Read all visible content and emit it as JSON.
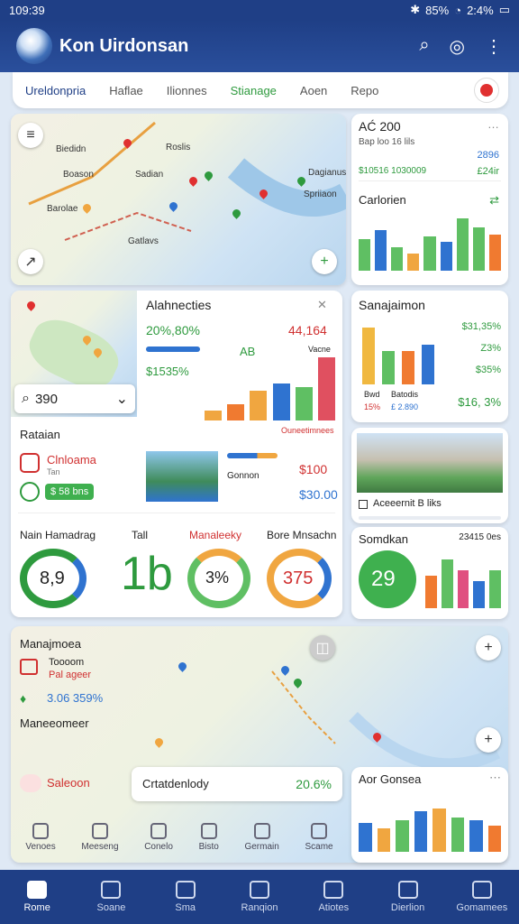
{
  "status": {
    "time": "109:39",
    "battery": "85%",
    "signal": "2:4%"
  },
  "app": {
    "title": "Kon Uirdonsan"
  },
  "tabs": [
    {
      "label": "Ureldonpria"
    },
    {
      "label": "Haflae"
    },
    {
      "label": "Ilionnes"
    },
    {
      "label": "Stianage"
    },
    {
      "label": "Aoen"
    },
    {
      "label": "Repo"
    }
  ],
  "map1": {
    "labels": [
      "Biedidn",
      "Roslis",
      "Boason",
      "Sadian",
      "Dagianus",
      "Barolae",
      "Gatlavs",
      "Spriiaon"
    ]
  },
  "stats1": {
    "title": "AĆ 200",
    "sub": "Bap loo 16 lils",
    "v1": "2896",
    "l1": "$10516 1030009",
    "v2": "£24ir",
    "section": "Carlorien",
    "bars": [
      {
        "v": 55,
        "c": "#5fbf63"
      },
      {
        "v": 70,
        "c": "#2f73d0"
      },
      {
        "v": 40,
        "c": "#5fbf63"
      },
      {
        "v": 30,
        "c": "#f0a640"
      },
      {
        "v": 60,
        "c": "#5fbf63"
      },
      {
        "v": 50,
        "c": "#2f73d0"
      },
      {
        "v": 90,
        "c": "#5fbf63"
      },
      {
        "v": 75,
        "c": "#5fbf63"
      },
      {
        "v": 62,
        "c": "#f07a30"
      }
    ]
  },
  "search": {
    "value": "390"
  },
  "alerts": {
    "title": "Alahnecties",
    "pct": "20%,80%",
    "value": "44,164",
    "sub": "$1535%",
    "ab": "AB",
    "vlabel": "Vacne",
    "legend": "Ouneetimnees",
    "bars": [
      {
        "v": 15,
        "c": "#f0a640"
      },
      {
        "v": 25,
        "c": "#f07a30"
      },
      {
        "v": 45,
        "c": "#f0a640"
      },
      {
        "v": 55,
        "c": "#2f73d0"
      },
      {
        "v": 50,
        "c": "#5fbf63"
      },
      {
        "v": 95,
        "c": "#e05060"
      }
    ]
  },
  "sanajaimon": {
    "title": "Sanajaimon",
    "v1": "$31,35%",
    "v2": "Z3%",
    "v3": "$35%",
    "v4": "$16, 3%",
    "foot1": "Bwd",
    "foot2": "Batodis",
    "foot3": "15%",
    "foot4": "£ 2.890",
    "bars": [
      {
        "v": 85,
        "c": "#f0b840"
      },
      {
        "v": 50,
        "c": "#5fbf63"
      },
      {
        "v": 50,
        "c": "#f07a30"
      },
      {
        "v": 60,
        "c": "#2f73d0"
      }
    ]
  },
  "rataian": {
    "title": "Rataian",
    "item1": "Clnloama",
    "item1sub": "Tan",
    "badge": "$ 58 bns",
    "imglabel": "Gonnon",
    "p1": "$100",
    "p2": "$30.00"
  },
  "photo": {
    "caption": "Aceeernit B liks"
  },
  "gauges": {
    "g1label": "Nain Hamadrag",
    "g1": "8,9",
    "g2label": "Tall",
    "g2": "1b",
    "g3label": "Manaleeky",
    "g3": "3%",
    "g4label": "Bore Mnsachn",
    "g4": "375"
  },
  "samo": {
    "title": "Somdkan",
    "sub": "23415 0es",
    "value": "29",
    "bars": [
      {
        "v": 60,
        "c": "#f07a30"
      },
      {
        "v": 90,
        "c": "#5fbf63"
      },
      {
        "v": 70,
        "c": "#e05080"
      },
      {
        "v": 50,
        "c": "#2f73d0"
      },
      {
        "v": 70,
        "c": "#5fbf63"
      }
    ]
  },
  "bottom": {
    "title": "Manajmoea",
    "item1": "Toooom",
    "item1sub": "Pal ageer",
    "stat": "3.06 359%",
    "section": "Maneeomeer",
    "item2": "Saleoon",
    "cardlabel": "Crtatdenlody",
    "cardval": "20.6%",
    "chartTitle": "Aor Gonsea",
    "bars": [
      {
        "v": 50,
        "c": "#2f73d0"
      },
      {
        "v": 40,
        "c": "#f0a640"
      },
      {
        "v": 55,
        "c": "#5fbf63"
      },
      {
        "v": 70,
        "c": "#2f73d0"
      },
      {
        "v": 75,
        "c": "#f0a640"
      },
      {
        "v": 60,
        "c": "#5fbf63"
      },
      {
        "v": 55,
        "c": "#2f73d0"
      },
      {
        "v": 45,
        "c": "#f07a30"
      }
    ]
  },
  "subnav": [
    {
      "label": "Venoes"
    },
    {
      "label": "Meeseng"
    },
    {
      "label": "Conelo"
    },
    {
      "label": "Bisto"
    },
    {
      "label": "Germain"
    },
    {
      "label": "Scame"
    }
  ],
  "navbar": [
    {
      "label": "Rome"
    },
    {
      "label": "Soane"
    },
    {
      "label": "Sma"
    },
    {
      "label": "Ranqion"
    },
    {
      "label": "Atiotes"
    },
    {
      "label": "Dierlion"
    },
    {
      "label": "Gomamees"
    }
  ]
}
